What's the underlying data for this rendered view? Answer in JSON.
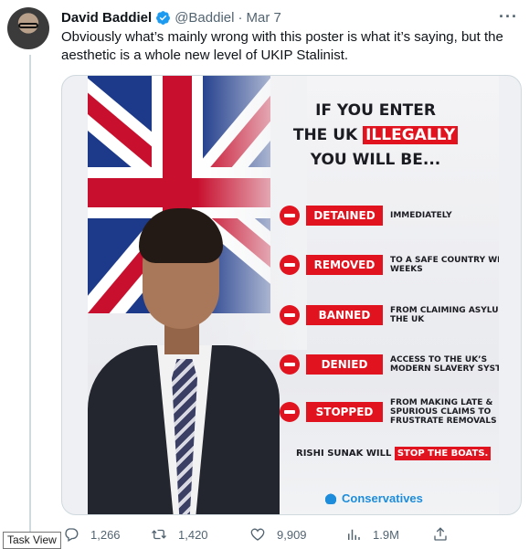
{
  "tweet": {
    "author_name": "David Baddiel",
    "handle": "@Baddiel",
    "separator": "·",
    "date": "Mar 7",
    "more_label": "···",
    "text": "Obviously what’s mainly wrong with this poster is what it’s saying, but the aesthetic is a whole new level of UKIP Stalinist."
  },
  "poster": {
    "headline_line1": "IF YOU ENTER",
    "headline_line2_prefix": "THE UK",
    "headline_line2_highlight": "ILLEGALLY",
    "headline_line3": "YOU WILL BE...",
    "items": [
      {
        "label": "DETAINED",
        "desc": "IMMEDIATELY"
      },
      {
        "label": "REMOVED",
        "desc": "TO A SAFE COUNTRY WITHIN WEEKS"
      },
      {
        "label": "BANNED",
        "desc": "FROM CLAIMING ASYLUM IN THE UK"
      },
      {
        "label": "DENIED",
        "desc": "ACCESS TO THE UK’S MODERN SLAVERY SYSTEM"
      },
      {
        "label": "STOPPED",
        "desc": "FROM MAKING LATE & SPURIOUS CLAIMS TO FRUSTRATE REMOVALS"
      }
    ],
    "footer_prefix": "RISHI SUNAK WILL",
    "footer_highlight": "STOP THE BOATS.",
    "party": "Conservatives"
  },
  "actions": {
    "replies": "1,266",
    "retweets": "1,420",
    "likes": "9,909",
    "views": "1.9M"
  },
  "taskbar": {
    "tooltip": "Task View"
  },
  "colors": {
    "accent_red": "#e1131f",
    "verified_blue": "#1d9bf0",
    "party_blue": "#1d8ddb",
    "muted_text": "#536471"
  }
}
